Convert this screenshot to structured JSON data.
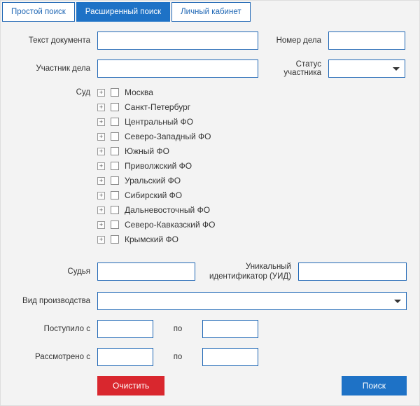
{
  "tabs": {
    "simple": "Простой поиск",
    "advanced": "Расширенный поиск",
    "cabinet": "Личный кабинет"
  },
  "labels": {
    "doc_text": "Текст документа",
    "case_number": "Номер дела",
    "participant": "Участник дела",
    "participant_status": "Статус участника",
    "court": "Суд",
    "judge": "Судья",
    "uid": "Уникальный идентификатор (УИД)",
    "proceeding_type": "Вид производства",
    "received_from": "Поступило с",
    "reviewed_from": "Рассмотрено с",
    "to": "по"
  },
  "courts": [
    "Москва",
    "Санкт-Петербург",
    "Центральный ФО",
    "Северо-Западный ФО",
    "Южный ФО",
    "Приволжский ФО",
    "Уральский ФО",
    "Сибирский ФО",
    "Дальневосточный ФО",
    "Северо-Кавказский ФО",
    "Крымский ФО"
  ],
  "buttons": {
    "clear": "Очистить",
    "search": "Поиск"
  },
  "values": {
    "doc_text": "",
    "case_number": "",
    "participant": "",
    "participant_status": "",
    "judge": "",
    "uid": "",
    "proceeding_type": "",
    "received_from": "",
    "received_to": "",
    "reviewed_from": "",
    "reviewed_to": ""
  }
}
